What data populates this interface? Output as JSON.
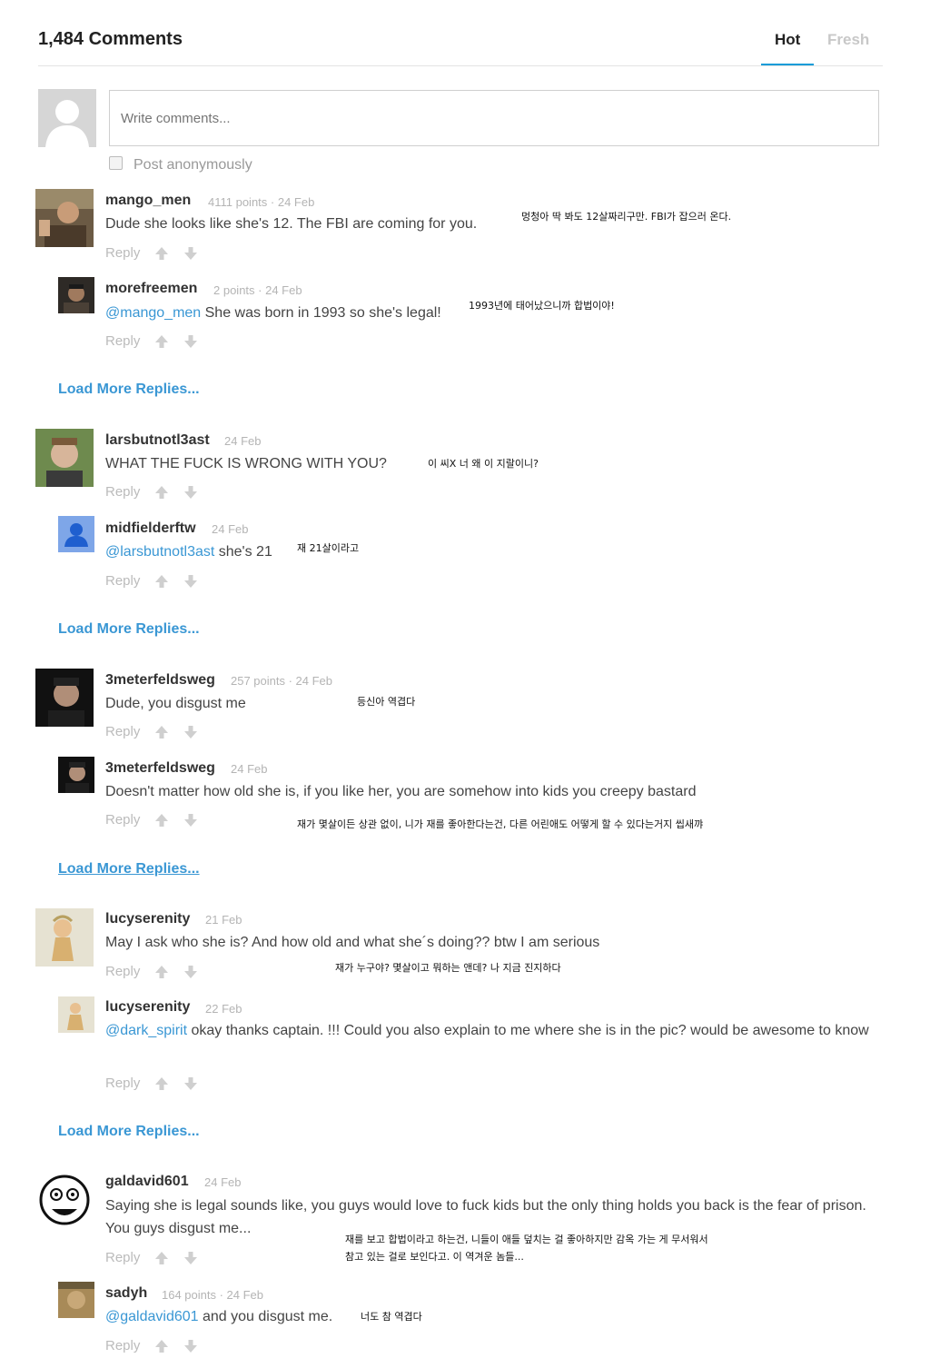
{
  "header": {
    "title": "1,484 Comments",
    "tabs": [
      "Hot",
      "Fresh"
    ],
    "active_tab": "Hot"
  },
  "composer": {
    "placeholder": "Write comments...",
    "anonymous_label": "Post anonymously"
  },
  "reply_label": "Reply",
  "load_more_label": "Load More Replies...",
  "threads": [
    {
      "comment": {
        "user": "mango_men",
        "meta": "4111 points · 24 Feb",
        "text": "Dude she looks like she's 12. The FBI are coming for you.",
        "translation": "멍청아 딱 봐도 12살짜리구만. FBI가 잡으러 온다."
      },
      "reply": {
        "user": "morefreemen",
        "meta": "2 points · 24 Feb",
        "mention": "@mango_men",
        "text": " She was born in 1993 so she's legal!",
        "translation": "1993년에 태어났으니까 합법이야!"
      }
    },
    {
      "comment": {
        "user": "larsbutnotl3ast",
        "meta": "24 Feb",
        "text": "WHAT THE FUCK IS WRONG WITH YOU?",
        "translation": "이 씨X 너 왜 이 지랄이니?"
      },
      "reply": {
        "user": "midfielderftw",
        "meta": "24 Feb",
        "mention": "@larsbutnotl3ast",
        "text": " she's 21",
        "translation": "재 21살이라고"
      }
    },
    {
      "comment": {
        "user": "3meterfeldsweg",
        "meta": "257 points · 24 Feb",
        "text": "Dude, you disgust me",
        "translation": "등신아 역겹다"
      },
      "reply": {
        "user": "3meterfeldsweg",
        "meta": "24 Feb",
        "mention": "",
        "text": "Doesn't matter how old she is, if you like her, you are somehow into kids you creepy bastard",
        "translation": "재가 몇살이든 상관 없이, 니가 재를 좋아한다는건, 다른 어린애도 어떻게 할 수 있다는거지 씹새꺄"
      }
    },
    {
      "comment": {
        "user": "lucyserenity",
        "meta": "21 Feb",
        "text": "May I ask who she is? And how old and what she´s doing?? btw I am serious",
        "translation": "재가 누구야? 몇살이고 뭐하는 앤데? 나 지금 진지하다"
      },
      "reply": {
        "user": "lucyserenity",
        "meta": "22 Feb",
        "mention": "@dark_spirit",
        "text": " okay thanks captain. !!! Could you also explain to me where she is in the pic? would be awesome to know",
        "translation": ""
      }
    },
    {
      "comment": {
        "user": "galdavid601",
        "meta": "24 Feb",
        "text": "Saying she is legal sounds like, you guys would love to fuck kids but the only thing holds you back is the fear of prison. You guys disgust me...",
        "translation": "재를 보고 합법이라고 하는건, 니들이 애들 덮치는 걸 좋아하지만 감옥 가는 게 무서워서\n참고 있는 걸로 보인다고. 이 역겨운 놈들..."
      },
      "reply": {
        "user": "sadyh",
        "meta": "164 points · 24 Feb",
        "mention": "@galdavid601",
        "text": " and you disgust me.",
        "translation": "너도 참 역겹다"
      }
    }
  ],
  "colors": {
    "accent": "#3a97d4",
    "tab_underline": "#0d9bd8",
    "muted": "#b4b4b4"
  },
  "icons": [
    "user-placeholder-icon",
    "checkbox-icon",
    "upvote-arrow-icon",
    "downvote-arrow-icon"
  ]
}
